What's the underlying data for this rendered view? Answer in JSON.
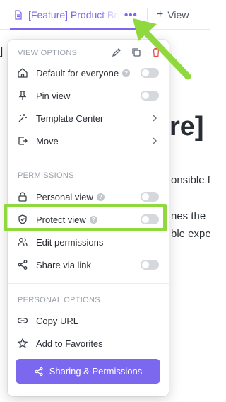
{
  "tabbar": {
    "active_tab": "[Feature] Product Brief",
    "add_view_label": "View"
  },
  "background": {
    "bracket_text": "]",
    "heading_fragment": "re]",
    "line1": "onsible f",
    "line2": "nes the",
    "line3": "ble expe"
  },
  "menu": {
    "view_options_label": "VIEW OPTIONS",
    "view_items": [
      {
        "label": "Default for everyone",
        "icon": "home-icon"
      },
      {
        "label": "Pin view",
        "icon": "pin-icon"
      },
      {
        "label": "Template Center",
        "icon": "sparkle-icon"
      },
      {
        "label": "Move",
        "icon": "move-icon"
      }
    ],
    "permissions_label": "PERMISSIONS",
    "permission_items": [
      {
        "label": "Personal view",
        "icon": "lock-icon"
      },
      {
        "label": "Protect view",
        "icon": "shield-icon"
      },
      {
        "label": "Edit permissions",
        "icon": "users-icon"
      },
      {
        "label": "Share via link",
        "icon": "share-icon"
      }
    ],
    "personal_options_label": "PERSONAL OPTIONS",
    "personal_items": [
      {
        "label": "Copy URL",
        "icon": "link-icon"
      },
      {
        "label": "Add to Favorites",
        "icon": "star-icon"
      }
    ],
    "cta_label": "Sharing & Permissions"
  },
  "colors": {
    "accent": "#7b68ee",
    "highlight": "#8fd93f"
  }
}
